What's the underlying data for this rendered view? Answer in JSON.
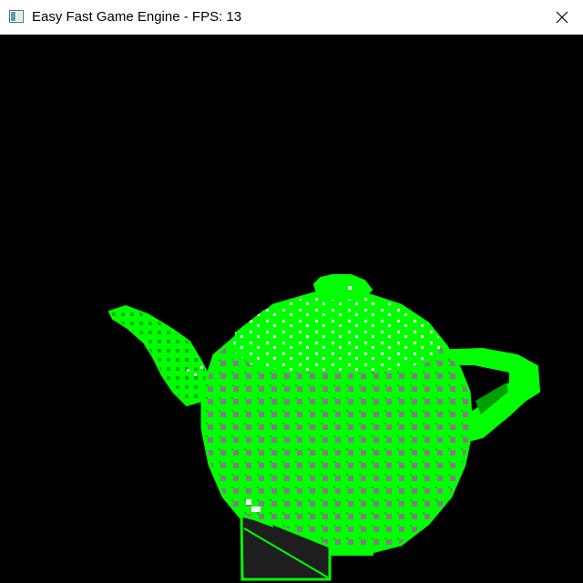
{
  "window": {
    "title": "Easy Fast Game Engine - FPS: 13",
    "icon": "app-window-icon",
    "close_icon": "close-icon"
  },
  "viewport": {
    "background": "#000000",
    "model": "teapot",
    "wire_color": "#00ff00",
    "shade_color": "#808080",
    "highlight_color": "#ffffff"
  }
}
